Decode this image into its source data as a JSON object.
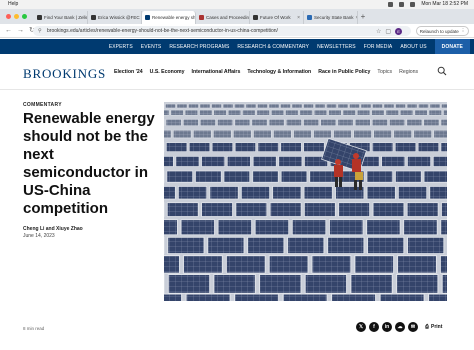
{
  "menubar": {
    "help": "Help",
    "datetime": "Mon Mar 18  2:52 PM"
  },
  "tabs": [
    {
      "label": "Find Your Bank | Zelle",
      "active": false
    },
    {
      "label": "Erica Wissick @FEC",
      "active": false
    },
    {
      "label": "Renewable energy sh",
      "active": true
    },
    {
      "label": "Cases and Proceedin",
      "active": false
    },
    {
      "label": "Future Of Work",
      "active": false
    },
    {
      "label": "Security State Bank",
      "active": false
    }
  ],
  "browser": {
    "url": "brookings.edu/articles/renewable-energy-should-not-be-the-next-semiconductor-in-us-china-competition/",
    "relaunch": "Relaunch to update",
    "avatar_initial": "E"
  },
  "topnav": [
    "EXPERTS",
    "EVENTS",
    "RESEARCH PROGRAMS",
    "RESEARCH & COMMENTARY",
    "NEWSLETTERS",
    "FOR MEDIA",
    "ABOUT US"
  ],
  "donate": "DONATE",
  "site": {
    "logo": "BROOKINGS",
    "nav": [
      "Election '24",
      "U.S. Economy",
      "International Affairs",
      "Technology & Information",
      "Race in Public Policy"
    ],
    "nav_light": [
      "Topics",
      "Regions"
    ]
  },
  "article": {
    "kicker": "COMMENTARY",
    "headline": "Renewable energy should not be the next semiconductor in US-China competition",
    "authors": "Cheng Li and Xiuye Zhao",
    "date": "June 14, 2023",
    "read_time": "8 min read",
    "print": "Print"
  },
  "colors": {
    "navy": "#003a70",
    "donate": "#1c5fa8"
  }
}
